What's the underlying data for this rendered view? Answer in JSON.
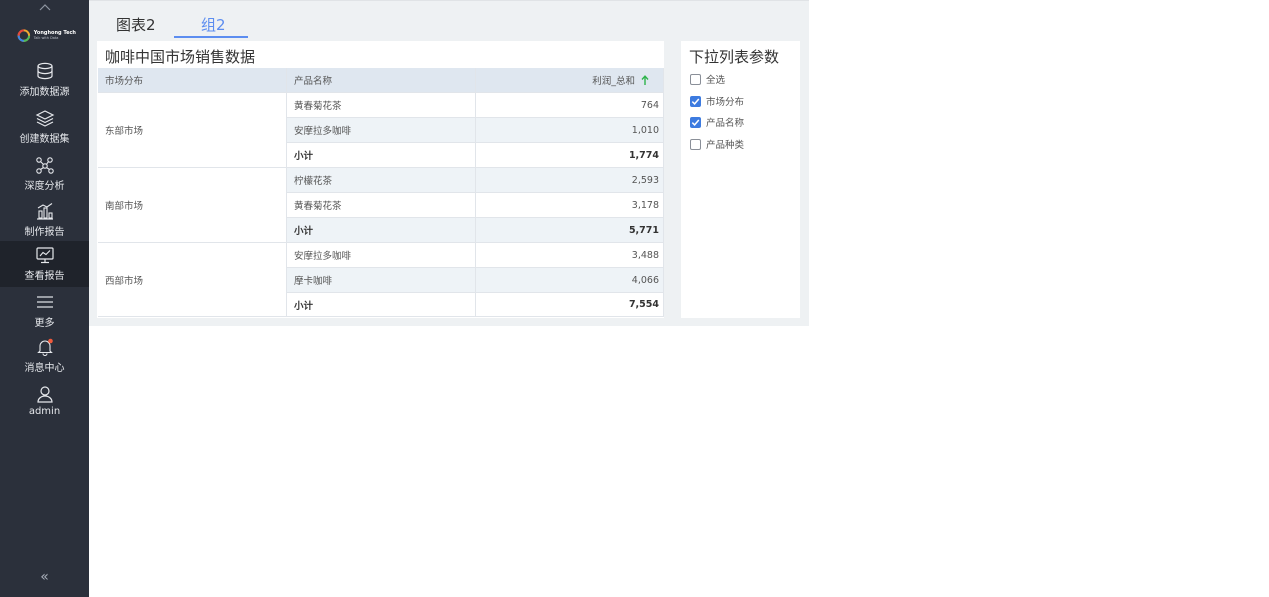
{
  "sidebar": {
    "logo": {
      "name": "Yonghong Tech",
      "tagline": "Talk with Data"
    },
    "items": [
      {
        "label": "添加数据源",
        "icon": "database-icon",
        "active": false
      },
      {
        "label": "创建数据集",
        "icon": "layers-icon",
        "active": false
      },
      {
        "label": "深度分析",
        "icon": "network-icon",
        "active": false
      },
      {
        "label": "制作报告",
        "icon": "bar-chart-icon",
        "active": false
      },
      {
        "label": "查看报告",
        "icon": "monitor-chart-icon",
        "active": true
      },
      {
        "label": "更多",
        "icon": "menu-icon",
        "active": false
      },
      {
        "label": "消息中心",
        "icon": "bell-icon",
        "active": false
      },
      {
        "label": "admin",
        "icon": "user-icon",
        "active": false
      }
    ],
    "collapse_label": "«"
  },
  "tabs": [
    {
      "label": "图表2",
      "active": false
    },
    {
      "label": "组2",
      "active": true
    }
  ],
  "table": {
    "title": "咖啡中国市场销售数据",
    "headers": {
      "market": "市场分布",
      "product": "产品名称",
      "profit": "利润_总和"
    },
    "groups": [
      {
        "market": "东部市场",
        "rows": [
          {
            "product": "黄春菊花茶",
            "value": "764"
          },
          {
            "product": "安摩拉多咖啡",
            "value": "1,010"
          },
          {
            "product": "小计",
            "value": "1,774",
            "subtotal": true
          }
        ]
      },
      {
        "market": "南部市场",
        "rows": [
          {
            "product": "柠檬花茶",
            "value": "2,593"
          },
          {
            "product": "黄春菊花茶",
            "value": "3,178"
          },
          {
            "product": "小计",
            "value": "5,771",
            "subtotal": true
          }
        ]
      },
      {
        "market": "西部市场",
        "rows": [
          {
            "product": "安摩拉多咖啡",
            "value": "3,488"
          },
          {
            "product": "摩卡咖啡",
            "value": "4,066"
          },
          {
            "product": "小计",
            "value": "7,554",
            "subtotal": true
          }
        ]
      }
    ]
  },
  "filter": {
    "title": "下拉列表参数",
    "options": [
      {
        "label": "全选",
        "checked": false
      },
      {
        "label": "市场分布",
        "checked": true
      },
      {
        "label": "产品名称",
        "checked": true
      },
      {
        "label": "产品种类",
        "checked": false
      }
    ]
  },
  "colors": {
    "sidebar_bg": "#2b303b",
    "accent": "#5c8df0",
    "checkbox_checked": "#3d7be0",
    "sort_arrow": "#2db44a",
    "notification_dot": "#f05a3c"
  }
}
